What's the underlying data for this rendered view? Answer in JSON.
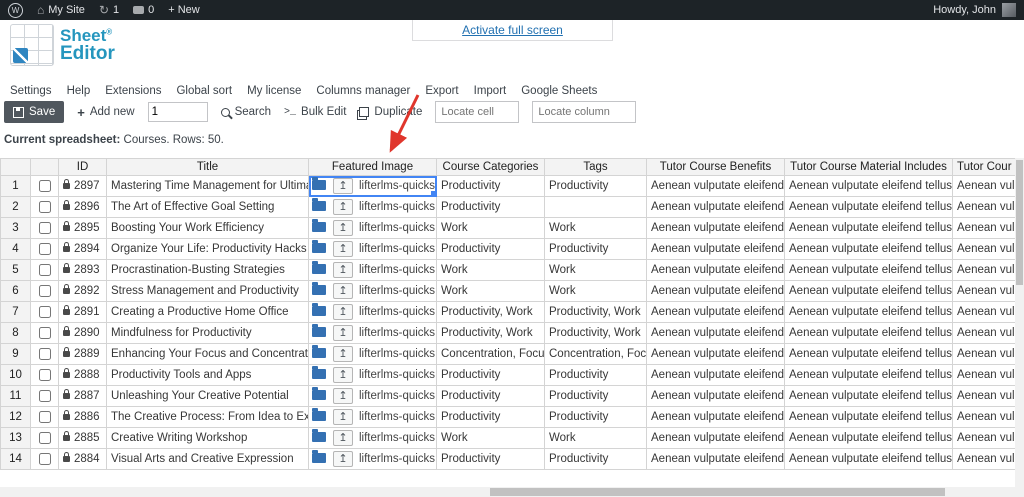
{
  "colors": {
    "accent_red": "#e0362c",
    "selection_blue": "#4285f4",
    "brand_teal": "#2596be",
    "adminbar_bg": "#1d2327"
  },
  "admin_bar": {
    "wp": "W",
    "my_site": "My Site",
    "updates_count": "1",
    "comments_count": "0",
    "new_label": "+ New",
    "howdy": "Howdy, John"
  },
  "icons": {
    "home": "⌂",
    "refresh": "↻",
    "upload": "↥"
  },
  "fullscreen_link": "Activate full screen",
  "logo": {
    "line1": "Sheet",
    "reg": "®",
    "line2": "Editor"
  },
  "menu": {
    "items": [
      "Settings",
      "Help",
      "Extensions",
      "Global sort",
      "My license",
      "Columns manager",
      "Export",
      "Import",
      "Google Sheets"
    ]
  },
  "toolbar": {
    "save": "Save",
    "plus": "+",
    "add_new": "Add new",
    "add_new_value": "1",
    "search": "Search",
    "bulk_prefix": ">_",
    "bulk_edit": "Bulk Edit",
    "duplicate": "Duplicate",
    "locate_cell_placeholder": "Locate cell",
    "locate_column_placeholder": "Locate column"
  },
  "status": {
    "label": "Current spreadsheet:",
    "value": "Courses. Rows: 50."
  },
  "table": {
    "headers": [
      "ID",
      "Title",
      "Featured Image",
      "Course Categories",
      "Tags",
      "Tutor Course Benefits",
      "Tutor Course Material Includes",
      "Tutor Cour"
    ],
    "rows": [
      {
        "n": "1",
        "id": "2897",
        "title": "Mastering Time Management for Ultimate Pr...",
        "image": "lifterlms-quicks...",
        "categories": "Productivity",
        "tags": "Productivity",
        "benefits": "Aenean vulputate eleifend tel...",
        "materials": "Aenean vulputate eleifend tellus Susp...",
        "extra": "Aenean vulputa..."
      },
      {
        "n": "2",
        "id": "2896",
        "title": "The Art of Effective Goal Setting",
        "image": "lifterlms-quicks...",
        "categories": "Productivity",
        "tags": "",
        "benefits": "Aenean vulputate eleifend tel...",
        "materials": "Aenean vulputate eleifend tellus Susp...",
        "extra": "Aenean vulputa..."
      },
      {
        "n": "3",
        "id": "2895",
        "title": "Boosting Your Work Efficiency",
        "image": "lifterlms-quicks...",
        "categories": "Work",
        "tags": "Work",
        "benefits": "Aenean vulputate eleifend tel...",
        "materials": "Aenean vulputate eleifend tellus Susp...",
        "extra": "Aenean vulputa..."
      },
      {
        "n": "4",
        "id": "2894",
        "title": "Organize Your Life: Productivity Hacks",
        "image": "lifterlms-quicks...",
        "categories": "Productivity",
        "tags": "Productivity",
        "benefits": "Aenean vulputate eleifend tel...",
        "materials": "Aenean vulputate eleifend tellus Susp...",
        "extra": "Aenean vulputa..."
      },
      {
        "n": "5",
        "id": "2893",
        "title": "Procrastination-Busting Strategies",
        "image": "lifterlms-quicks...",
        "categories": "Work",
        "tags": "Work",
        "benefits": "Aenean vulputate eleifend tel...",
        "materials": "Aenean vulputate eleifend tellus Susp...",
        "extra": "Aenean vulputa..."
      },
      {
        "n": "6",
        "id": "2892",
        "title": "Stress Management and Productivity",
        "image": "lifterlms-quicks...",
        "categories": "Work",
        "tags": "Work",
        "benefits": "Aenean vulputate eleifend tel...",
        "materials": "Aenean vulputate eleifend tellus Susp...",
        "extra": "Aenean vulputa..."
      },
      {
        "n": "7",
        "id": "2891",
        "title": "Creating a Productive Home Office",
        "image": "lifterlms-quicks...",
        "categories": "Productivity, Work",
        "tags": "Productivity, Work",
        "benefits": "Aenean vulputate eleifend tel...",
        "materials": "Aenean vulputate eleifend tellus Susp...",
        "extra": "Aenean vulputa..."
      },
      {
        "n": "8",
        "id": "2890",
        "title": "Mindfulness for Productivity",
        "image": "lifterlms-quicks...",
        "categories": "Productivity, Work",
        "tags": "Productivity, Work",
        "benefits": "Aenean vulputate eleifend tel...",
        "materials": "Aenean vulputate eleifend tellus Susp...",
        "extra": "Aenean vulputa..."
      },
      {
        "n": "9",
        "id": "2889",
        "title": "Enhancing Your Focus and Concentration",
        "image": "lifterlms-quicks...",
        "categories": "Concentration, Focu...",
        "tags": "Concentration, Focu...",
        "benefits": "Aenean vulputate eleifend tel...",
        "materials": "Aenean vulputate eleifend tellus Susp...",
        "extra": "Aenean vulputa..."
      },
      {
        "n": "10",
        "id": "2888",
        "title": "Productivity Tools and Apps",
        "image": "lifterlms-quicks...",
        "categories": "Productivity",
        "tags": "Productivity",
        "benefits": "Aenean vulputate eleifend tel...",
        "materials": "Aenean vulputate eleifend tellus Susp...",
        "extra": "Aenean vulputa..."
      },
      {
        "n": "11",
        "id": "2887",
        "title": "Unleashing Your Creative Potential",
        "image": "lifterlms-quicks...",
        "categories": "Productivity",
        "tags": "Productivity",
        "benefits": "Aenean vulputate eleifend tel...",
        "materials": "Aenean vulputate eleifend tellus Susp...",
        "extra": "Aenean vulputa..."
      },
      {
        "n": "12",
        "id": "2886",
        "title": "The Creative Process: From Idea to Execution",
        "image": "lifterlms-quicks...",
        "categories": "Productivity",
        "tags": "Productivity",
        "benefits": "Aenean vulputate eleifend tel...",
        "materials": "Aenean vulputate eleifend tellus Susp...",
        "extra": "Aenean vulputa..."
      },
      {
        "n": "13",
        "id": "2885",
        "title": "Creative Writing Workshop",
        "image": "lifterlms-quicks...",
        "categories": "Work",
        "tags": "Work",
        "benefits": "Aenean vulputate eleifend tel...",
        "materials": "Aenean vulputate eleifend tellus Susp...",
        "extra": "Aenean vulputa..."
      },
      {
        "n": "14",
        "id": "2884",
        "title": "Visual Arts and Creative Expression",
        "image": "lifterlms-quicks...",
        "categories": "Productivity",
        "tags": "Productivity",
        "benefits": "Aenean vulputate eleifend tel...",
        "materials": "Aenean vulputate eleifend tellus Susp...",
        "extra": "Aenean vulputa..."
      }
    ]
  }
}
